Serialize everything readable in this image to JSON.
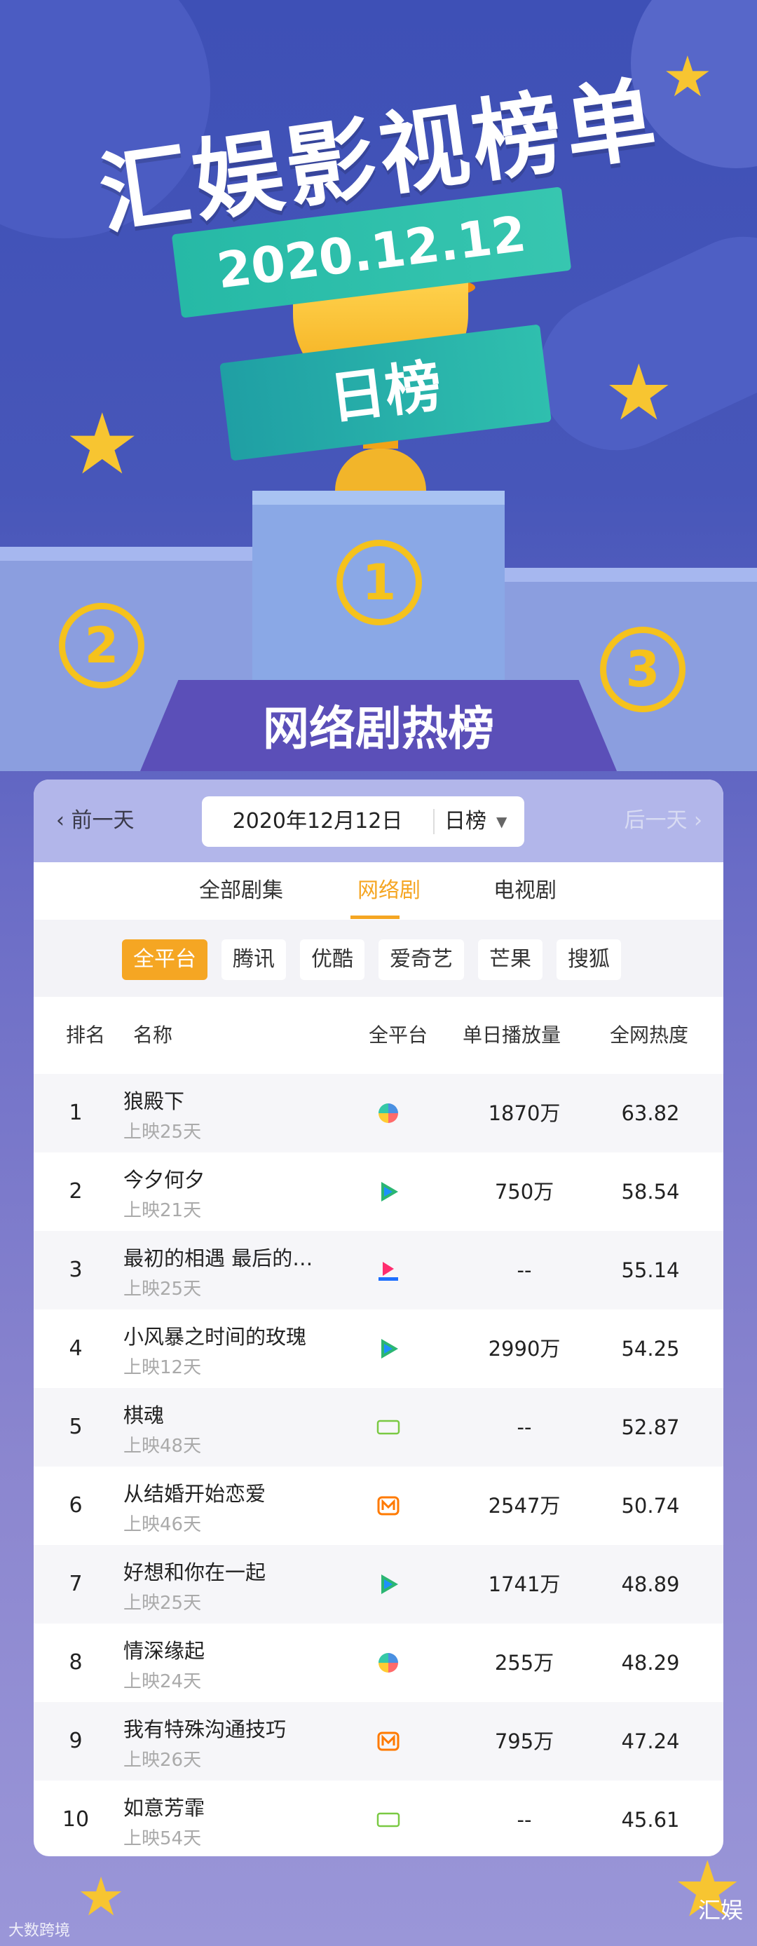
{
  "header": {
    "title": "汇娱影视榜单",
    "date": "2020.12.12",
    "subtitle": "日榜",
    "section_title": "网络剧热榜",
    "medals": [
      "1",
      "2",
      "3"
    ]
  },
  "toolbar": {
    "prev_label": "前一天",
    "next_label": "后一天",
    "date_value": "2020年12月12日",
    "range_value": "日榜"
  },
  "tabs": [
    {
      "label": "全部剧集",
      "active": false
    },
    {
      "label": "网络剧",
      "active": true
    },
    {
      "label": "电视剧",
      "active": false
    }
  ],
  "platforms": [
    {
      "label": "全平台",
      "active": true
    },
    {
      "label": "腾讯",
      "active": false
    },
    {
      "label": "优酷",
      "active": false
    },
    {
      "label": "爱奇艺",
      "active": false
    },
    {
      "label": "芒果",
      "active": false
    },
    {
      "label": "搜狐",
      "active": false
    }
  ],
  "table": {
    "headers": {
      "rank": "排名",
      "name": "名称",
      "platform": "全平台",
      "plays": "单日播放量",
      "heat": "全网热度"
    },
    "rows": [
      {
        "rank": "1",
        "name": "狼殿下",
        "days": "上映25天",
        "platform_icon": "multi-platform-icon",
        "plays": "1870万",
        "heat": "63.82"
      },
      {
        "rank": "2",
        "name": "今夕何夕",
        "days": "上映21天",
        "platform_icon": "tencent-video-icon",
        "plays": "750万",
        "heat": "58.54"
      },
      {
        "rank": "3",
        "name": "最初的相遇 最后的…",
        "days": "上映25天",
        "platform_icon": "youku-icon",
        "plays": "--",
        "heat": "55.14"
      },
      {
        "rank": "4",
        "name": "小风暴之时间的玫瑰",
        "days": "上映12天",
        "platform_icon": "tencent-video-icon",
        "plays": "2990万",
        "heat": "54.25"
      },
      {
        "rank": "5",
        "name": "棋魂",
        "days": "上映48天",
        "platform_icon": "iqiyi-icon",
        "plays": "--",
        "heat": "52.87"
      },
      {
        "rank": "6",
        "name": "从结婚开始恋爱",
        "days": "上映46天",
        "platform_icon": "mango-tv-icon",
        "plays": "2547万",
        "heat": "50.74"
      },
      {
        "rank": "7",
        "name": "好想和你在一起",
        "days": "上映25天",
        "platform_icon": "tencent-video-icon",
        "plays": "1741万",
        "heat": "48.89"
      },
      {
        "rank": "8",
        "name": "情深缘起",
        "days": "上映24天",
        "platform_icon": "multi-platform-icon",
        "plays": "255万",
        "heat": "48.29"
      },
      {
        "rank": "9",
        "name": "我有特殊沟通技巧",
        "days": "上映26天",
        "platform_icon": "mango-tv-icon",
        "plays": "795万",
        "heat": "47.24"
      },
      {
        "rank": "10",
        "name": "如意芳霏",
        "days": "上映54天",
        "platform_icon": "iqiyi-icon",
        "plays": "--",
        "heat": "45.61"
      }
    ]
  },
  "footer": {
    "brand": "汇娱",
    "watermark": "大数跨境"
  },
  "colors": {
    "accent": "#f5a623",
    "background": "#4756b9",
    "ribbon": "#2fbfae",
    "gold": "#f5c21c"
  }
}
